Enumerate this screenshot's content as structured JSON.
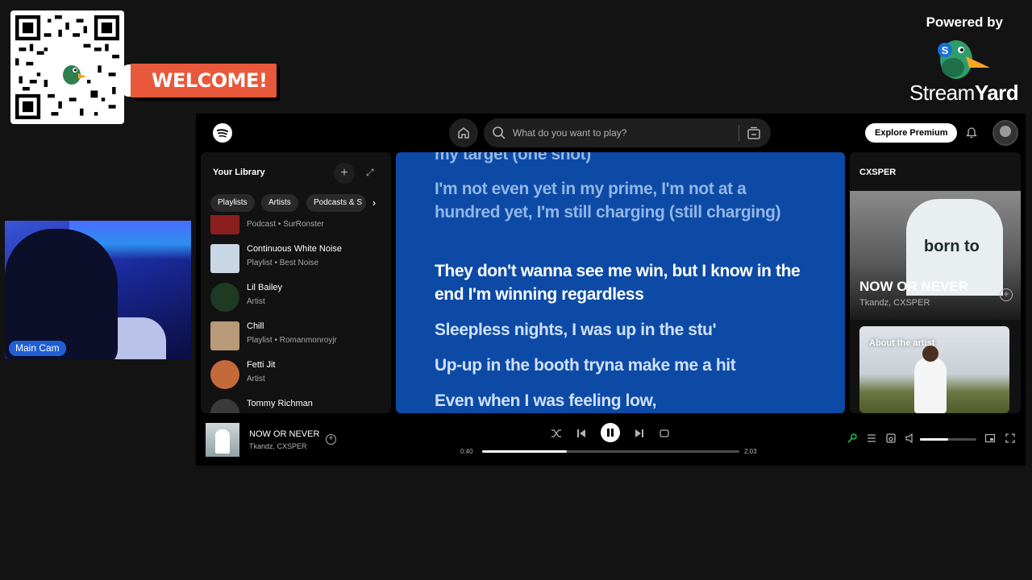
{
  "overlay": {
    "welcome_text": "WELCOME!",
    "powered_by": "Powered by",
    "brand_stream": "Stream",
    "brand_yard": "Yard",
    "cam_label": "Main Cam"
  },
  "topbar": {
    "search_placeholder": "What do you want to play?",
    "premium_label": "Explore Premium"
  },
  "library": {
    "title": "Your Library",
    "chips": [
      "Playlists",
      "Artists",
      "Podcasts & S"
    ],
    "items": [
      {
        "name": "",
        "sub": "Podcast • SurRonster",
        "color": "#8b1e1e"
      },
      {
        "name": "Continuous White Noise",
        "sub": "Playlist • Best Noise",
        "color": "#c9d6e6"
      },
      {
        "name": "Lil Bailey",
        "sub": "Artist",
        "color": "#1e3a22"
      },
      {
        "name": "Chill",
        "sub": "Playlist • Romanmonroyjr",
        "color": "#b89a78"
      },
      {
        "name": "Fetti Jit",
        "sub": "Artist",
        "color": "#c46a3a"
      },
      {
        "name": "Tommy Richman",
        "sub": "",
        "color": "#3a3a3a"
      }
    ]
  },
  "lyrics": {
    "lines": [
      {
        "text": "my target (one shot)",
        "state": "past"
      },
      {
        "text": "I'm not even yet in my prime, I'm not at a hundred yet, I'm still charging (still charging)",
        "state": "past"
      },
      {
        "text": "They don't wanna see me win, but I know in the end I'm winning regardless",
        "state": "active"
      },
      {
        "text": "Sleepless nights, I was up in the stu'",
        "state": "next"
      },
      {
        "text": "Up-up in the booth tryna make me a hit",
        "state": "next"
      },
      {
        "text": "Even when I was feeling low,",
        "state": "next"
      }
    ]
  },
  "now_playing": {
    "artist_header": "CXSPER",
    "shirt_text": "born to",
    "title": "NOW OR NEVER",
    "artists": "Tkandz, CXSPER",
    "about_label": "About the artist"
  },
  "player": {
    "title": "NOW OR NEVER",
    "artists": "Tkandz, CXSPER",
    "elapsed": "0:40",
    "duration": "2:03",
    "progress": 0.33,
    "volume": 0.5,
    "accent": "#1ed760"
  }
}
